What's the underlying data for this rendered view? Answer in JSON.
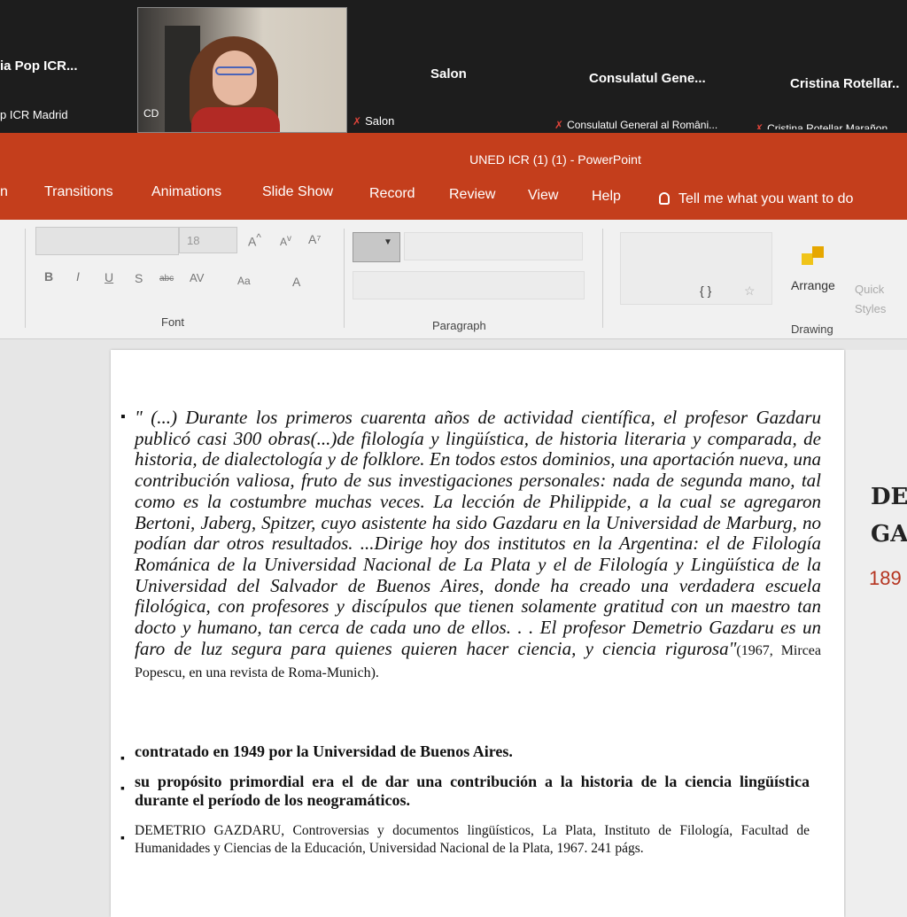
{
  "meeting": {
    "tiles": [
      {
        "name": "ia Pop ICR...",
        "caption": "p ICR Madrid"
      },
      {
        "name": "Salon",
        "caption": "Salon"
      },
      {
        "name": "Consulatul Gene...",
        "caption": "Consulatul General al Români..."
      },
      {
        "name": "Cristina Rotellar..",
        "caption": "Cristina Rotellar Marañon"
      }
    ],
    "video_tile_initials": "CD"
  },
  "window": {
    "title": "UNED ICR (1) (1)  -  PowerPoint"
  },
  "ribbon": {
    "tabs": [
      "n",
      "Transitions",
      "Animations",
      "Slide Show",
      "Record",
      "Review",
      "View",
      "Help"
    ],
    "tell_me": "Tell me what you want to do",
    "font_size": "18",
    "groups": {
      "font": "Font",
      "paragraph": "Paragraph",
      "drawing": "Drawing"
    },
    "font_buttons": [
      "B",
      "I",
      "U",
      "S",
      "abc",
      "AV",
      "Aa",
      "A"
    ],
    "arrange_label": "Arrange",
    "quick_styles_label": "Quick Styles"
  },
  "slide": {
    "quote": "\" (...) Durante los primeros cuarenta años de actividad científica, el profesor Gazdaru publicó casi 300 obras(...)de filología y lingüística, de historia literaria y comparada, de historia, de dialectología y de folklore. En todos estos dominios, una aportación nueva, una contribución valiosa, fruto de sus investigaciones personales: nada de segunda mano, tal como es la costumbre muchas veces. La lección de Philippide, a la cual se agregaron Bertoni, Jaberg, Spitzer, cuyo asistente ha sido Gazdaru en la Universidad de Marburg, no podían dar otros resultados. ...Dirige hoy dos institutos en la Argentina: el de Filología Románica de la Universidad Nacional de La Plata y el de Filología y Lingüística de la Universidad del Salvador de Buenos Aires, donde ha creado una verdadera escuela filológica, con profesores y discípulos que tienen solamente gratitud con un maestro tan docto y humano, tan cerca de cada uno de ellos. . . El profesor Demetrio Gazdaru es un faro de luz segura para quienes quieren hacer ciencia, y ciencia rigurosa\"",
    "quote_source": "(1967, Mircea Popescu, en una revista de Roma-Munich).",
    "bullet2": "contratado en 1949 por la Universidad de Buenos Aires.",
    "bullet3": "su propósito primordial era el de dar una contribución a la historia de la ciencia lingüística durante el período de los neogramáticos.",
    "bullet4": "DEMETRIO GAZDARU, Controversias y documentos lingüísticos, La Plata, Instituto de Filología, Facultad de Humanidades y Ciencias de la Educación, Universidad Nacional de la Plata, 1967. 241 págs."
  },
  "next_slide": {
    "line1": "DE",
    "line2": "GA",
    "line3": "189"
  },
  "colors": {
    "accent": "#c43e1c",
    "mic_muted": "#e0443a"
  }
}
